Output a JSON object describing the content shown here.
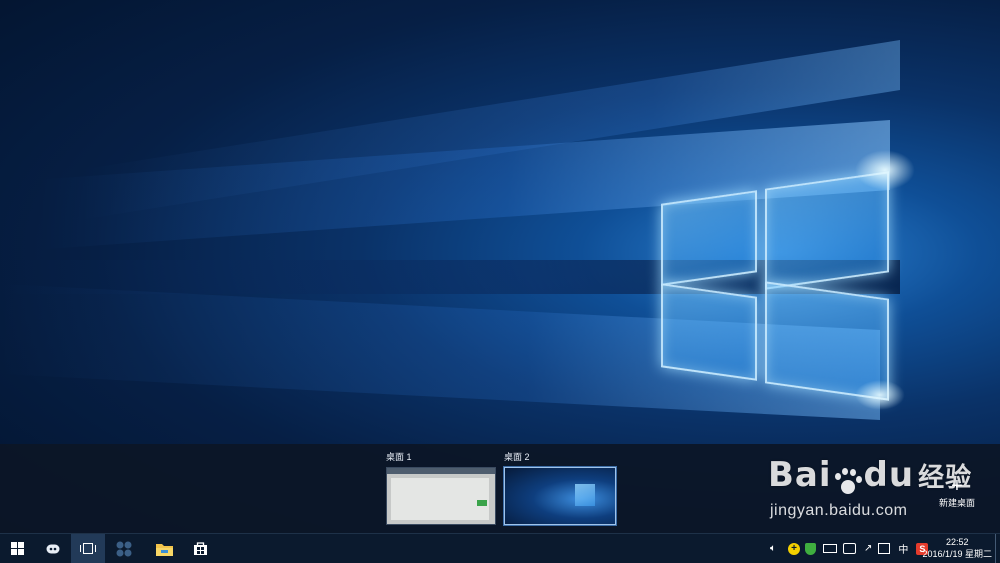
{
  "task_view": {
    "desktops": [
      {
        "label": "桌面 1",
        "active": false
      },
      {
        "label": "桌面 2",
        "active": true
      }
    ],
    "new_desktop": {
      "icon": "plus-icon",
      "label": "新建桌面"
    }
  },
  "watermark": {
    "brand_text": "Bai",
    "brand_text2": "du",
    "brand_cn": "经验",
    "url": "jingyan.baidu.com"
  },
  "taskbar": {
    "buttons": [
      {
        "name": "start-button",
        "icon": "windows-icon"
      },
      {
        "name": "cortana-button",
        "icon": "cortana-icon"
      },
      {
        "name": "task-view-button",
        "icon": "task-view-icon",
        "active": true
      },
      {
        "name": "app-button",
        "icon": "app-icon"
      },
      {
        "name": "file-explorer-button",
        "icon": "folder-icon"
      },
      {
        "name": "store-button",
        "icon": "store-icon"
      }
    ],
    "tray": {
      "ime_label": "中",
      "app_label": "S"
    },
    "clock": {
      "time": "22:52",
      "date": "2016/1/19 星期二"
    }
  },
  "colors": {
    "taskbar": "#0b1a2e",
    "taskview_strip": "#0c1626",
    "active_thumb_border": "#9fc3ea"
  }
}
